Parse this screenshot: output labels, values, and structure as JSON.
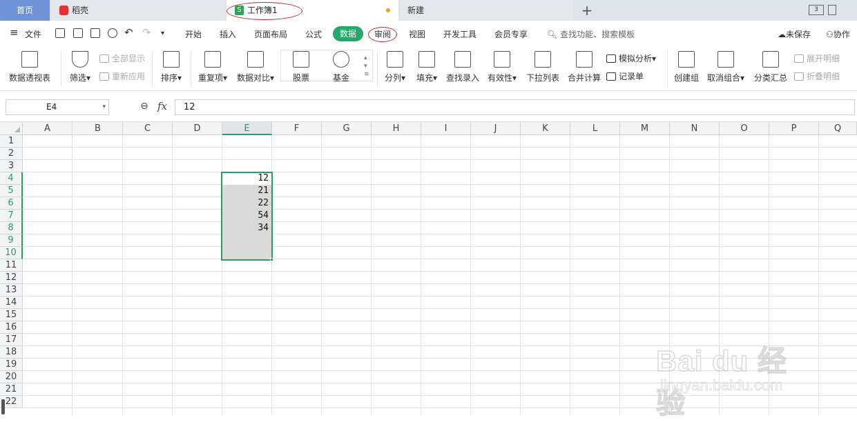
{
  "tabs": {
    "home": "首页",
    "daoke": "稻壳",
    "workbook": "工作簿1",
    "new": "新建",
    "add": "+",
    "window_badge": "3"
  },
  "menu": {
    "file": "文件",
    "items": [
      "开始",
      "插入",
      "页面布局",
      "公式",
      "数据",
      "审阅",
      "视图",
      "开发工具",
      "会员专享"
    ],
    "search": "查找功能、搜索模板",
    "unsaved": "未保存",
    "collab": "协作"
  },
  "ribbon": {
    "pivot": "数据透视表",
    "filter": "筛选",
    "show_all": "全部显示",
    "reapply": "重新应用",
    "sort": "排序",
    "duplicates": "重复项",
    "compare": "数据对比",
    "stock": "股票",
    "fund": "基金",
    "split": "分列",
    "fill": "填充",
    "lookup": "查找录入",
    "validity": "有效性",
    "dropdown": "下拉列表",
    "consolidate": "合并计算",
    "simulate": "模拟分析",
    "record": "记录单",
    "group": "创建组",
    "ungroup": "取消组合",
    "subtotal": "分类汇总",
    "expand": "展开明细",
    "collapse": "折叠明细"
  },
  "formula": {
    "namebox": "E4",
    "fx": "fx",
    "value": "12"
  },
  "grid": {
    "columns": [
      "A",
      "B",
      "C",
      "D",
      "E",
      "F",
      "G",
      "H",
      "I",
      "J",
      "K",
      "L",
      "M",
      "N",
      "O",
      "P",
      "Q"
    ],
    "rows": [
      "1",
      "2",
      "3",
      "4",
      "5",
      "6",
      "7",
      "8",
      "9",
      "10",
      "11",
      "12",
      "13",
      "14",
      "15",
      "16",
      "17",
      "18",
      "19",
      "20",
      "21",
      "22"
    ],
    "selected_column": "E",
    "selected_rows": [
      "4",
      "5",
      "6",
      "7",
      "8",
      "9",
      "10"
    ],
    "cells_E": [
      "12",
      "21",
      "22",
      "54",
      "34"
    ],
    "accent_color": "#2a9d63"
  },
  "watermark": {
    "brand": "Bai du 经验",
    "url": "jingyan.baidu.com"
  }
}
